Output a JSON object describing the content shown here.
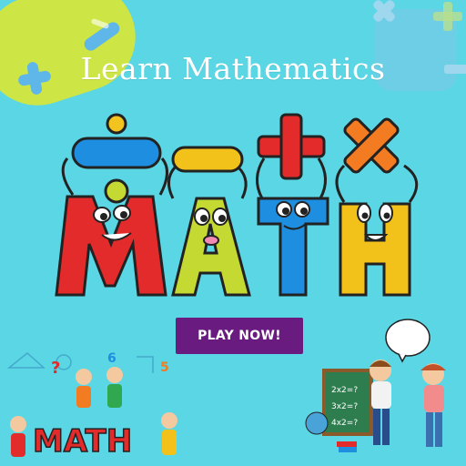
{
  "page": {
    "title": "Learn Mathematics",
    "logo_text": "MATH",
    "play_button_label": "PLAY NOW!",
    "small_logo_text": "MATH",
    "chalkboard": [
      "2x2=?",
      "3x2=?",
      "4x2=?"
    ]
  },
  "colors": {
    "background": "#5ad6e4",
    "button": "#6a1b7f",
    "letter_m": "#e32b2b",
    "letter_a": "#c4d932",
    "letter_t": "#1e8fe0",
    "letter_h": "#f2c21b"
  },
  "icons": [
    "plus-icon",
    "minus-icon",
    "multiply-icon",
    "divide-icon",
    "speech-bubble-icon"
  ]
}
